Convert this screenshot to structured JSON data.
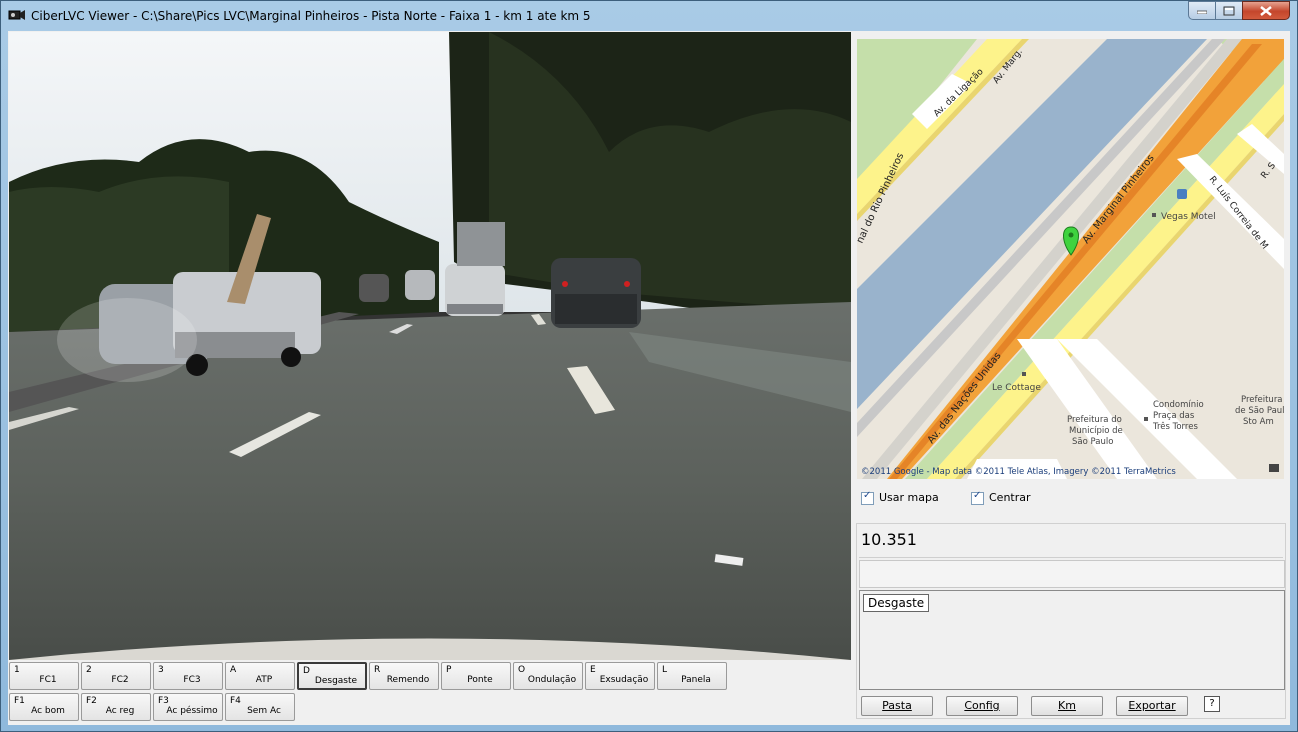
{
  "window": {
    "title": "CiberLVC Viewer - C:\\Share\\Pics LVC\\Marginal Pinheiros - Pista Norte - Faixa 1 - km 1 ate km 5"
  },
  "fkeys": [
    {
      "key": "1",
      "label": "FC1"
    },
    {
      "key": "2",
      "label": "FC2"
    },
    {
      "key": "3",
      "label": "FC3"
    },
    {
      "key": "A",
      "label": "ATP"
    },
    {
      "key": "D",
      "label": "Desgaste",
      "selected": true
    },
    {
      "key": "R",
      "label": "Remendo"
    },
    {
      "key": "P",
      "label": "Ponte"
    },
    {
      "key": "O",
      "label": "Ondulação"
    },
    {
      "key": "E",
      "label": "Exsudação"
    },
    {
      "key": "L",
      "label": "Panela"
    },
    {
      "key": "F1",
      "label": "Ac bom"
    },
    {
      "key": "F2",
      "label": "Ac reg"
    },
    {
      "key": "F3",
      "label": "Ac péssimo"
    },
    {
      "key": "F4",
      "label": "Sem Ac"
    }
  ],
  "map": {
    "labels": {
      "av_marginal": "Av. Marginal Pinheiros",
      "av_nacoes": "Av. das Nações Unidas",
      "av_ligacao": "Av. da Ligação",
      "av_marg": "Av. Marg.",
      "rio_pinheiros": "nal do Rio Pinheiros",
      "r_luis": "R. Luís Correia de M",
      "r_s": "R. S",
      "vegas": "Vegas Motel",
      "le_cottage": "Le Cottage",
      "prefeitura1_l1": "Prefeitura do",
      "prefeitura1_l2": "Município de",
      "prefeitura1_l3": "São Paulo",
      "condominio_l1": "Condomínio",
      "condominio_l2": "Praça das",
      "condominio_l3": "Três Torres",
      "prefeitura2_l1": "Prefeitura do",
      "prefeitura2_l2": "de São Paul",
      "prefeitura2_l3": "Sto Am"
    },
    "attribution": "©2011 Google - Map data ©2011 Tele Atlas, Imagery ©2011 TerraMetrics",
    "colors": {
      "water": "#99b3cc",
      "highway": "#f2a23a",
      "road": "#fdf38b",
      "park": "#c5dfaa"
    }
  },
  "options": {
    "usar_mapa": "Usar mapa",
    "centrar": "Centrar"
  },
  "panel": {
    "km_value": "10.351",
    "selected_tag": "Desgaste"
  },
  "buttons": {
    "pasta": "Pasta",
    "config": "Config",
    "km": "Km",
    "exportar": "Exportar",
    "help": "?"
  }
}
